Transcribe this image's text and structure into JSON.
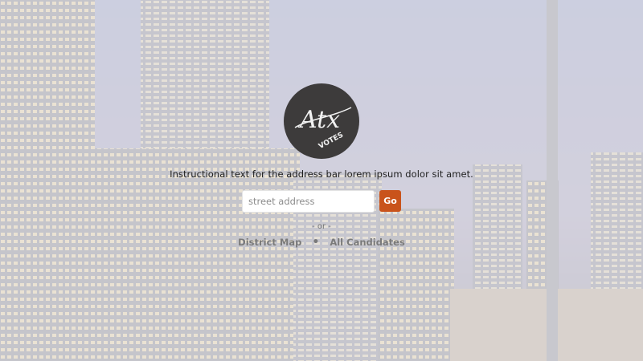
{
  "logo": {
    "text_line1": "Atx",
    "text_line2": "VOTES",
    "icon": "atx-votes-logo"
  },
  "instructions": {
    "text": "Instructional text for the address bar lorem ipsum dolor sit amet."
  },
  "search": {
    "placeholder": "street address",
    "value": "",
    "go_label": "Go"
  },
  "divider": {
    "text": "- or -"
  },
  "links": {
    "district_map": "District Map",
    "separator": "•",
    "all_candidates": "All Candidates"
  },
  "colors": {
    "accent": "#c9531b",
    "logo_bg": "#3d3b3b",
    "overlay": "#ececf0"
  },
  "background": {
    "icon": "city-skyline-night-photo"
  }
}
